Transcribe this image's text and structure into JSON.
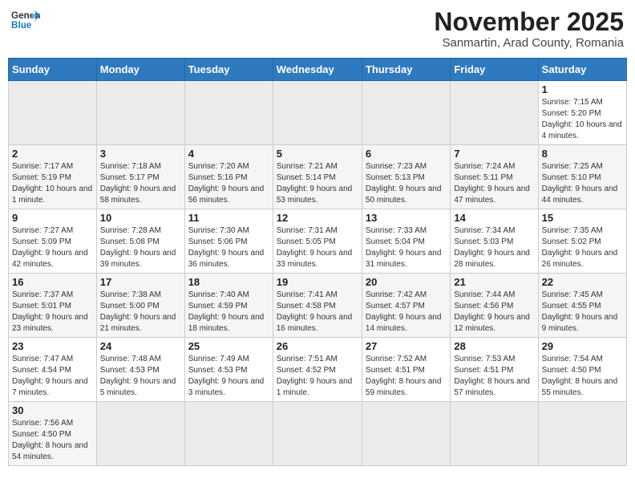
{
  "header": {
    "logo_general": "General",
    "logo_blue": "Blue",
    "month": "November 2025",
    "location": "Sanmartin, Arad County, Romania"
  },
  "days_of_week": [
    "Sunday",
    "Monday",
    "Tuesday",
    "Wednesday",
    "Thursday",
    "Friday",
    "Saturday"
  ],
  "weeks": [
    {
      "days": [
        {
          "num": "",
          "info": "",
          "empty": true
        },
        {
          "num": "",
          "info": "",
          "empty": true
        },
        {
          "num": "",
          "info": "",
          "empty": true
        },
        {
          "num": "",
          "info": "",
          "empty": true
        },
        {
          "num": "",
          "info": "",
          "empty": true
        },
        {
          "num": "",
          "info": "",
          "empty": true
        },
        {
          "num": "1",
          "info": "Sunrise: 7:15 AM\nSunset: 5:20 PM\nDaylight: 10 hours and 4 minutes.",
          "empty": false
        }
      ]
    },
    {
      "days": [
        {
          "num": "2",
          "info": "Sunrise: 7:17 AM\nSunset: 5:19 PM\nDaylight: 10 hours and 1 minute.",
          "empty": false
        },
        {
          "num": "3",
          "info": "Sunrise: 7:18 AM\nSunset: 5:17 PM\nDaylight: 9 hours and 58 minutes.",
          "empty": false
        },
        {
          "num": "4",
          "info": "Sunrise: 7:20 AM\nSunset: 5:16 PM\nDaylight: 9 hours and 56 minutes.",
          "empty": false
        },
        {
          "num": "5",
          "info": "Sunrise: 7:21 AM\nSunset: 5:14 PM\nDaylight: 9 hours and 53 minutes.",
          "empty": false
        },
        {
          "num": "6",
          "info": "Sunrise: 7:23 AM\nSunset: 5:13 PM\nDaylight: 9 hours and 50 minutes.",
          "empty": false
        },
        {
          "num": "7",
          "info": "Sunrise: 7:24 AM\nSunset: 5:11 PM\nDaylight: 9 hours and 47 minutes.",
          "empty": false
        },
        {
          "num": "8",
          "info": "Sunrise: 7:25 AM\nSunset: 5:10 PM\nDaylight: 9 hours and 44 minutes.",
          "empty": false
        }
      ]
    },
    {
      "days": [
        {
          "num": "9",
          "info": "Sunrise: 7:27 AM\nSunset: 5:09 PM\nDaylight: 9 hours and 42 minutes.",
          "empty": false
        },
        {
          "num": "10",
          "info": "Sunrise: 7:28 AM\nSunset: 5:08 PM\nDaylight: 9 hours and 39 minutes.",
          "empty": false
        },
        {
          "num": "11",
          "info": "Sunrise: 7:30 AM\nSunset: 5:06 PM\nDaylight: 9 hours and 36 minutes.",
          "empty": false
        },
        {
          "num": "12",
          "info": "Sunrise: 7:31 AM\nSunset: 5:05 PM\nDaylight: 9 hours and 33 minutes.",
          "empty": false
        },
        {
          "num": "13",
          "info": "Sunrise: 7:33 AM\nSunset: 5:04 PM\nDaylight: 9 hours and 31 minutes.",
          "empty": false
        },
        {
          "num": "14",
          "info": "Sunrise: 7:34 AM\nSunset: 5:03 PM\nDaylight: 9 hours and 28 minutes.",
          "empty": false
        },
        {
          "num": "15",
          "info": "Sunrise: 7:35 AM\nSunset: 5:02 PM\nDaylight: 9 hours and 26 minutes.",
          "empty": false
        }
      ]
    },
    {
      "days": [
        {
          "num": "16",
          "info": "Sunrise: 7:37 AM\nSunset: 5:01 PM\nDaylight: 9 hours and 23 minutes.",
          "empty": false
        },
        {
          "num": "17",
          "info": "Sunrise: 7:38 AM\nSunset: 5:00 PM\nDaylight: 9 hours and 21 minutes.",
          "empty": false
        },
        {
          "num": "18",
          "info": "Sunrise: 7:40 AM\nSunset: 4:59 PM\nDaylight: 9 hours and 18 minutes.",
          "empty": false
        },
        {
          "num": "19",
          "info": "Sunrise: 7:41 AM\nSunset: 4:58 PM\nDaylight: 9 hours and 16 minutes.",
          "empty": false
        },
        {
          "num": "20",
          "info": "Sunrise: 7:42 AM\nSunset: 4:57 PM\nDaylight: 9 hours and 14 minutes.",
          "empty": false
        },
        {
          "num": "21",
          "info": "Sunrise: 7:44 AM\nSunset: 4:56 PM\nDaylight: 9 hours and 12 minutes.",
          "empty": false
        },
        {
          "num": "22",
          "info": "Sunrise: 7:45 AM\nSunset: 4:55 PM\nDaylight: 9 hours and 9 minutes.",
          "empty": false
        }
      ]
    },
    {
      "days": [
        {
          "num": "23",
          "info": "Sunrise: 7:47 AM\nSunset: 4:54 PM\nDaylight: 9 hours and 7 minutes.",
          "empty": false
        },
        {
          "num": "24",
          "info": "Sunrise: 7:48 AM\nSunset: 4:53 PM\nDaylight: 9 hours and 5 minutes.",
          "empty": false
        },
        {
          "num": "25",
          "info": "Sunrise: 7:49 AM\nSunset: 4:53 PM\nDaylight: 9 hours and 3 minutes.",
          "empty": false
        },
        {
          "num": "26",
          "info": "Sunrise: 7:51 AM\nSunset: 4:52 PM\nDaylight: 9 hours and 1 minute.",
          "empty": false
        },
        {
          "num": "27",
          "info": "Sunrise: 7:52 AM\nSunset: 4:51 PM\nDaylight: 8 hours and 59 minutes.",
          "empty": false
        },
        {
          "num": "28",
          "info": "Sunrise: 7:53 AM\nSunset: 4:51 PM\nDaylight: 8 hours and 57 minutes.",
          "empty": false
        },
        {
          "num": "29",
          "info": "Sunrise: 7:54 AM\nSunset: 4:50 PM\nDaylight: 8 hours and 55 minutes.",
          "empty": false
        }
      ]
    },
    {
      "days": [
        {
          "num": "30",
          "info": "Sunrise: 7:56 AM\nSunset: 4:50 PM\nDaylight: 8 hours and 54 minutes.",
          "empty": false
        },
        {
          "num": "",
          "info": "",
          "empty": true
        },
        {
          "num": "",
          "info": "",
          "empty": true
        },
        {
          "num": "",
          "info": "",
          "empty": true
        },
        {
          "num": "",
          "info": "",
          "empty": true
        },
        {
          "num": "",
          "info": "",
          "empty": true
        },
        {
          "num": "",
          "info": "",
          "empty": true
        }
      ]
    }
  ]
}
